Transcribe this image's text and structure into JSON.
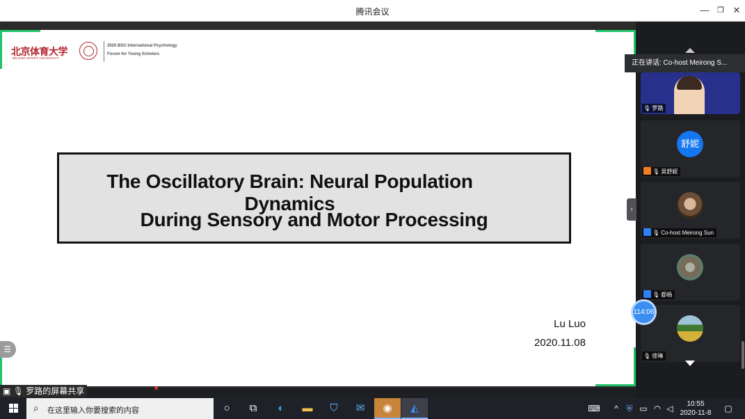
{
  "window": {
    "title": "腾讯会议"
  },
  "slide": {
    "logo_cn": "北京体育大学",
    "logo_en": "BEIJING SPORT UNIVERSITY",
    "forum_line1": "2020 BSU International Psychology",
    "forum_line2": "Forum for Young Scholars",
    "title_line1": "The Oscillatory Brain: Neural Population Dynamics",
    "title_line2": "During Sensory and Motor Processing",
    "author": "Lu Luo",
    "date": "2020.11.08"
  },
  "share": {
    "label": "罗路的屏幕共享"
  },
  "sidebar": {
    "speaking": "正在讲话: Co-host Meirong S...",
    "participants": [
      {
        "name": "罗路",
        "type": "video"
      },
      {
        "name": "吴舒妮",
        "avatar_text": "舒妮",
        "type": "avatar"
      },
      {
        "name": "Co-host Meirong Sun",
        "type": "photo"
      },
      {
        "name": "郄杨",
        "type": "photo"
      },
      {
        "name": "徐琳",
        "type": "photo"
      }
    ],
    "timer": "114:06"
  },
  "taskbar": {
    "search_placeholder": "在这里输入你要搜索的内容",
    "time": "10:55",
    "date": "2020-11-8"
  }
}
